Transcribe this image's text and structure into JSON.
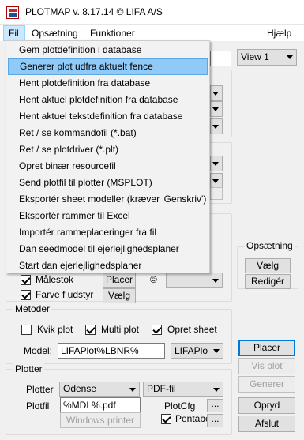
{
  "window": {
    "title": "PLOTMAP v. 8.17.14 © LIFA A/S"
  },
  "menubar": {
    "items": [
      "Fil",
      "Opsætning",
      "Funktioner"
    ],
    "help": "Hjælp"
  },
  "file_menu": {
    "items": [
      "Gem plotdefinition i database",
      "Generer plot udfra aktuelt fence",
      "Hent plotdefinition fra database",
      "Hent aktuel plotdefinition fra database",
      "Hent aktuel tekstdefinition fra database",
      "Ret / se kommandofil (*.bat)",
      "Ret / se plotdriver (*.plt)",
      "Opret binær resourcefil",
      "Send plotfil til plotter (MSPLOT)",
      "Eksportér sheet modeller (kræver 'Genskriv')",
      "Eksportér rammer til Excel",
      "Importér rammeplaceringer fra fil",
      "Dan seedmodel til ejerlejlighedsplaner",
      "Start dan ejerlejlighedsplaner"
    ],
    "highlighted_index": 1
  },
  "right_panel": {
    "view_combo": "View 1",
    "opsaetning_label": "Opsætning",
    "vaelg_button": "Vælg",
    "rediger_button": "Redigér"
  },
  "options": {
    "malestok_label": "Målestok",
    "malestok_checked": true,
    "farve_label": "Farve f udstyr",
    "farve_checked": true,
    "placer_button": "Placer",
    "vaelg_button": "Vælg",
    "copyright_symbol": "©"
  },
  "metoder": {
    "title": "Metoder",
    "kvik_label": "Kvik plot",
    "kvik_checked": false,
    "multi_label": "Multi plot",
    "multi_checked": true,
    "sheet_label": "Opret sheet",
    "sheet_checked": true,
    "model_label": "Model:",
    "model_value": "LIFAPlot%LBNR%",
    "model_combo": "LIFAPlo"
  },
  "actions": {
    "placer": "Placer",
    "vis_plot": "Vis plot",
    "generer": "Generer",
    "opryd": "Opryd",
    "afslut": "Afslut"
  },
  "plotter": {
    "title": "Plotter",
    "plotter_label": "Plotter",
    "plotter_value": "Odense",
    "format_value": "PDF-fil",
    "plotfil_label": "Plotfil",
    "plotfil_value": "%MDL%.pdf",
    "plotcfg_label": "PlotCfg",
    "browse_label": "...",
    "windows_printer": "Windows printer",
    "pentabel_label": "Pentabel",
    "pentabel_checked": true
  }
}
